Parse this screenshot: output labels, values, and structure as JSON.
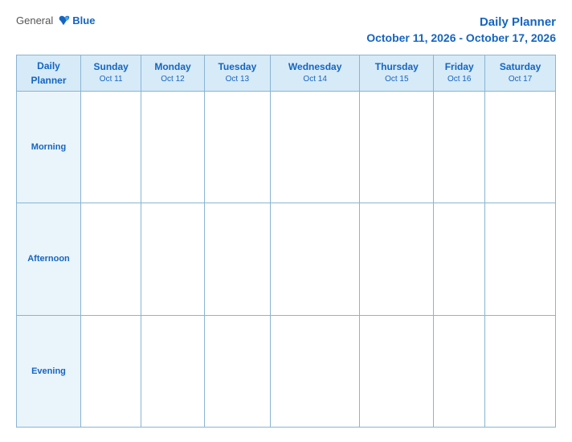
{
  "header": {
    "logo": {
      "general": "General",
      "blue": "Blue"
    },
    "title": "Daily Planner",
    "date_range": "October 11, 2026 - October 17, 2026"
  },
  "columns": [
    {
      "id": "daily-planner",
      "name": "Daily\nPlanner",
      "date": ""
    },
    {
      "id": "sunday",
      "name": "Sunday",
      "date": "Oct 11"
    },
    {
      "id": "monday",
      "name": "Monday",
      "date": "Oct 12"
    },
    {
      "id": "tuesday",
      "name": "Tuesday",
      "date": "Oct 13"
    },
    {
      "id": "wednesday",
      "name": "Wednesday",
      "date": "Oct 14"
    },
    {
      "id": "thursday",
      "name": "Thursday",
      "date": "Oct 15"
    },
    {
      "id": "friday",
      "name": "Friday",
      "date": "Oct 16"
    },
    {
      "id": "saturday",
      "name": "Saturday",
      "date": "Oct 17"
    }
  ],
  "rows": [
    {
      "id": "morning",
      "label": "Morning"
    },
    {
      "id": "afternoon",
      "label": "Afternoon"
    },
    {
      "id": "evening",
      "label": "Evening"
    }
  ]
}
